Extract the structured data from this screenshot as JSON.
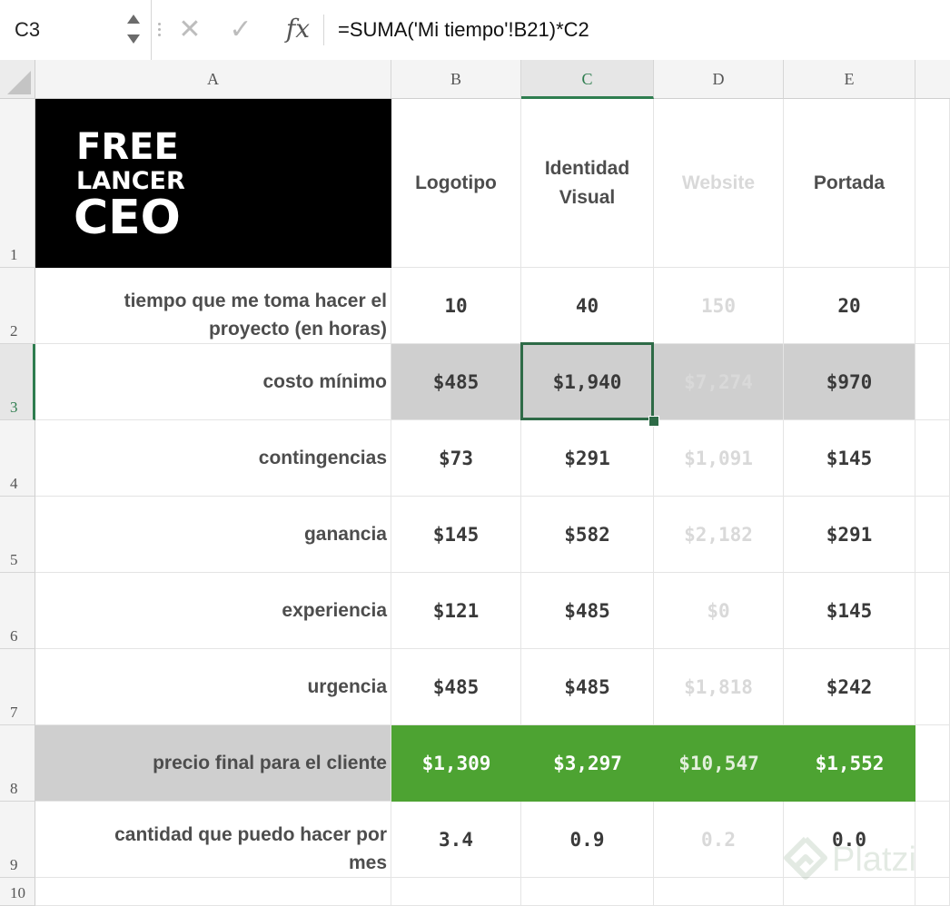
{
  "formula_bar": {
    "cell_ref": "C3",
    "formula": "=SUMA('Mi tiempo'!B21)*C2",
    "cancel_glyph": "✕",
    "enter_glyph": "✓",
    "fx_label": "fx",
    "icons": [
      "cancel-icon",
      "enter-icon",
      "function-icon",
      "stepper-icon"
    ]
  },
  "columns": [
    "A",
    "B",
    "C",
    "D",
    "E"
  ],
  "active_column": "C",
  "rows": [
    "1",
    "2",
    "3",
    "4",
    "5",
    "6",
    "7",
    "8",
    "9",
    "10"
  ],
  "active_row": "3",
  "logo": {
    "lines": [
      "FREE",
      "LANCER",
      "CEO"
    ]
  },
  "headers": {
    "logotipo": "Logotipo",
    "identidad": [
      "Identidad",
      "Visual"
    ],
    "website": "Website",
    "portada": "Portada"
  },
  "row_labels": {
    "r2": [
      "tiempo que me toma hacer el",
      "proyecto (en horas)"
    ],
    "r3": "costo mínimo",
    "r4": "contingencias",
    "r5": "ganancia",
    "r6": "experiencia",
    "r7": "urgencia",
    "r8": "precio final para el cliente",
    "r9": [
      "cantidad que puedo hacer por",
      "mes"
    ]
  },
  "values": {
    "r2": [
      "10",
      "40",
      "150",
      "20"
    ],
    "r3": [
      "$485",
      "$1,940",
      "$7,274",
      "$970"
    ],
    "r4": [
      "$73",
      "$291",
      "$1,091",
      "$145"
    ],
    "r5": [
      "$145",
      "$582",
      "$2,182",
      "$291"
    ],
    "r6": [
      "$121",
      "$485",
      "$0",
      "$145"
    ],
    "r7": [
      "$485",
      "$485",
      "$1,818",
      "$242"
    ],
    "r8": [
      "$1,309",
      "$3,297",
      "$10,547",
      "$1,552"
    ],
    "r9": [
      "3.4",
      "0.9",
      "0.2",
      "0.0"
    ]
  },
  "colors": {
    "accent_green": "#4da332",
    "selection_border": "#2e6b47",
    "highlight_gray": "#cfcfcf",
    "logo_bg": "#000000"
  },
  "watermark": "Platzi"
}
